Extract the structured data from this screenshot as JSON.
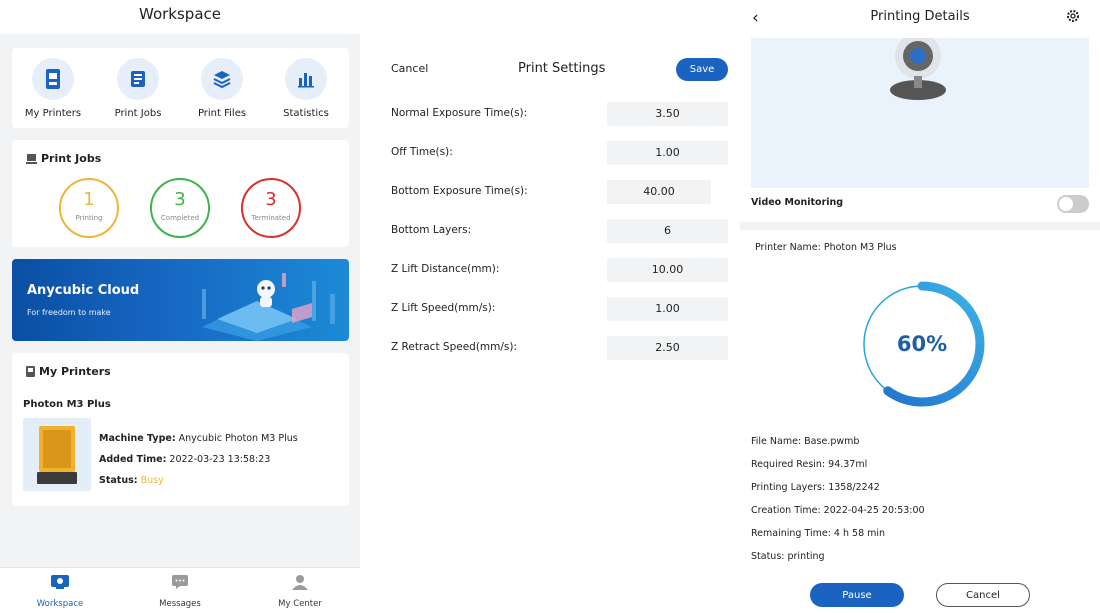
{
  "workspace": {
    "title": "Workspace",
    "quick_links": [
      {
        "label": "My Printers",
        "icon": "printer-icon"
      },
      {
        "label": "Print Jobs",
        "icon": "jobs-icon"
      },
      {
        "label": "Print Files",
        "icon": "files-icon"
      },
      {
        "label": "Statistics",
        "icon": "statistics-icon"
      }
    ],
    "print_jobs": {
      "heading": "Print Jobs",
      "printing": {
        "count": "1",
        "label": "Printing",
        "color": "#f0b43c"
      },
      "completed": {
        "count": "3",
        "label": "Completed",
        "color": "#3eb34a"
      },
      "terminated": {
        "count": "3",
        "label": "Terminated",
        "color": "#d9312b"
      }
    },
    "banner": {
      "title": "Anycubic Cloud",
      "subtitle": "For freedom to make"
    },
    "my_printers": {
      "heading": "My Printers",
      "printer_name": "Photon M3 Plus",
      "machine_type_label": "Machine Type:",
      "machine_type": "Anycubic Photon M3 Plus",
      "added_time_label": "Added Time:",
      "added_time": "2022-03-23 13:58:23",
      "status_label": "Status:",
      "status": "Busy"
    },
    "tabbar": [
      {
        "label": "Workspace",
        "icon": "workspace-icon",
        "active": true
      },
      {
        "label": "Messages",
        "icon": "messages-icon",
        "active": false
      },
      {
        "label": "My Center",
        "icon": "user-icon",
        "active": false
      }
    ]
  },
  "print_settings": {
    "cancel_label": "Cancel",
    "title": "Print Settings",
    "save_label": "Save",
    "rows": [
      {
        "label": "Normal Exposure Time(s):",
        "value": "3.50"
      },
      {
        "label": "Off Time(s):",
        "value": "1.00"
      },
      {
        "label": "Bottom Exposure Time(s):",
        "value": "40.00",
        "warning": true
      },
      {
        "label": "Bottom Layers:",
        "value": "6"
      },
      {
        "label": "Z Lift Distance(mm):",
        "value": "10.00"
      },
      {
        "label": "Z Lift Speed(mm/s):",
        "value": "1.00"
      },
      {
        "label": "Z Retract Speed(mm/s):",
        "value": "2.50"
      }
    ]
  },
  "printing_details": {
    "title": "Printing Details",
    "video_monitoring_label": "Video Monitoring",
    "video_monitoring_on": false,
    "printer_name": "Printer Name: Photon M3 Plus",
    "progress_text": "60%",
    "progress": 0.6,
    "file_name": "File Name: Base.pwmb",
    "required_resin": "Required Resin: 94.37ml",
    "printing_layers": "Printing Layers: 1358/2242",
    "creation_time": "Creation Time: 2022-04-25 20:53:00",
    "remaining_time": "Remaining Time: 4 h 58 min",
    "status": "Status: printing",
    "pause_label": "Pause",
    "cancel_label": "Cancel"
  },
  "colors": {
    "accent": "#1a63c0",
    "busy": "#f0b43c",
    "warning": "#f2a516"
  }
}
